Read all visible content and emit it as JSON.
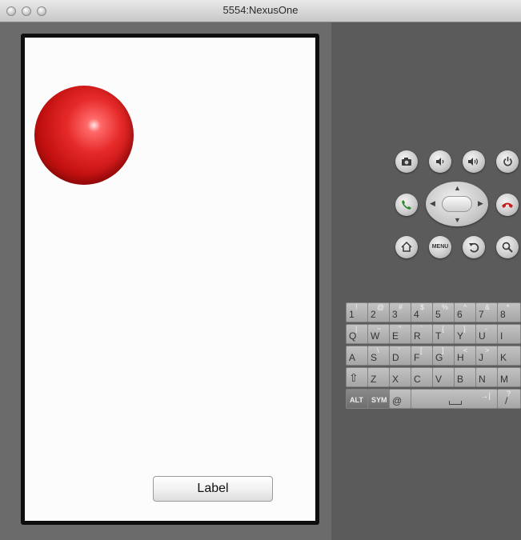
{
  "window": {
    "title": "5554:NexusOne"
  },
  "app": {
    "button_label": "Label"
  },
  "hardware": {
    "menu_label": "MENU",
    "dpad_arrows": {
      "up": "▲",
      "down": "▼",
      "left": "◀",
      "right": "▶"
    }
  },
  "keyboard": {
    "row1": [
      {
        "main": "1",
        "alt": "!"
      },
      {
        "main": "2",
        "alt": "@"
      },
      {
        "main": "3",
        "alt": "#"
      },
      {
        "main": "4",
        "alt": "$"
      },
      {
        "main": "5",
        "alt": "%"
      },
      {
        "main": "6",
        "alt": "^"
      },
      {
        "main": "7",
        "alt": "&"
      },
      {
        "main": "8",
        "alt": "*"
      }
    ],
    "row2": [
      {
        "main": "Q",
        "alt": "|"
      },
      {
        "main": "W",
        "alt": "~"
      },
      {
        "main": "E",
        "alt": "\""
      },
      {
        "main": "R",
        "alt": "`"
      },
      {
        "main": "T",
        "alt": "{"
      },
      {
        "main": "Y",
        "alt": "}"
      },
      {
        "main": "U",
        "alt": "-"
      },
      {
        "main": "I",
        "alt": ""
      }
    ],
    "row3": [
      {
        "main": "A",
        "alt": ""
      },
      {
        "main": "S",
        "alt": "\\"
      },
      {
        "main": "D",
        "alt": "'"
      },
      {
        "main": "F",
        "alt": "["
      },
      {
        "main": "G",
        "alt": "]"
      },
      {
        "main": "H",
        "alt": "<"
      },
      {
        "main": "J",
        "alt": ">"
      },
      {
        "main": "K",
        "alt": ""
      }
    ],
    "row4": [
      {
        "main": "⇧",
        "alt": ""
      },
      {
        "main": "Z",
        "alt": ""
      },
      {
        "main": "X",
        "alt": ""
      },
      {
        "main": "C",
        "alt": ""
      },
      {
        "main": "V",
        "alt": ""
      },
      {
        "main": "B",
        "alt": ""
      },
      {
        "main": "N",
        "alt": ""
      },
      {
        "main": "M",
        "alt": ""
      }
    ],
    "row5": {
      "alt_key": "ALT",
      "sym_key": "SYM",
      "at_key": "@",
      "slash_key": "/",
      "slash_alt": "?"
    }
  },
  "colors": {
    "call_green": "#2f8a2f",
    "end_red": "#c42020",
    "sphere_red": "#d81e1e"
  },
  "icons": [
    "camera-icon",
    "volume-down-icon",
    "volume-up-icon",
    "power-icon",
    "call-icon",
    "end-call-icon",
    "home-icon",
    "back-icon",
    "search-icon"
  ]
}
